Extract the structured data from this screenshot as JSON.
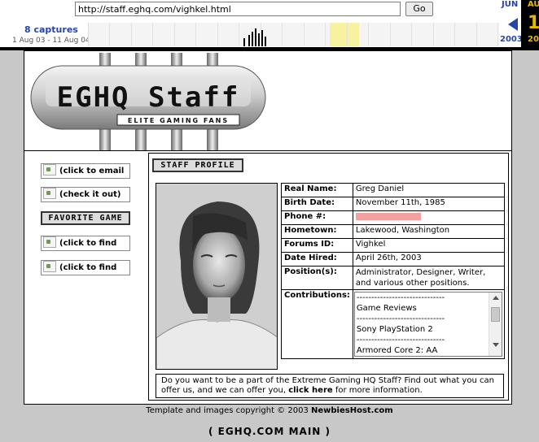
{
  "wayback": {
    "url": "http://staff.eghq.com/vighkel.html",
    "go_label": "Go",
    "captures": "8 captures",
    "date_range": "1 Aug 03 - 11 Aug 04",
    "prev_month": "JUN",
    "prev_year": "2003",
    "current_month": "AU",
    "current_day": "1",
    "current_year": "20"
  },
  "banner": {
    "logo_text": "EGHQ Staff",
    "tagline": "ELITE GAMING FANS"
  },
  "sidebar": {
    "buttons": [
      {
        "label": "(click to email"
      },
      {
        "label": "(check it out)"
      },
      {
        "label": "(click to find"
      },
      {
        "label": "(click to find"
      }
    ],
    "favorite_game": "FAVORITE GAME"
  },
  "profile": {
    "header": "STAFF PROFILE",
    "fields": [
      {
        "key": "Real Name:",
        "value": "Greg Daniel"
      },
      {
        "key": "Birth Date:",
        "value": "November 11th, 1985"
      },
      {
        "key": "Phone #:",
        "value": ""
      },
      {
        "key": "Hometown:",
        "value": "Lakewood, Washington"
      },
      {
        "key": "Forums ID:",
        "value": "Vighkel"
      },
      {
        "key": "Date Hired:",
        "value": "April 26th, 2003"
      },
      {
        "key": "Position(s):",
        "value": "Administrator, Designer, Writer, and various other positions."
      }
    ],
    "contributions_label": "Contributions:",
    "contributions": [
      "------------------------------",
      "Game Reviews",
      "------------------------------",
      "Sony PlayStation 2",
      "------------------------------",
      "Armored Core 2: AA"
    ],
    "join_text_1": "Do you want to be a part of the Extreme Gaming HQ Staff? Find out what you can offer us, and we can offer you,",
    "join_link": "click here",
    "join_text_2": "for more information."
  },
  "footer": {
    "copyright_prefix": "Template and images copyright © 2003",
    "copyright_owner": "NewbiesHost.com",
    "main_link": "( EGHQ.COM MAIN )"
  },
  "colors": {
    "wayback_blue": "#2446a8",
    "wayback_gold": "#e6b800",
    "redaction": "#f2a0a0"
  }
}
